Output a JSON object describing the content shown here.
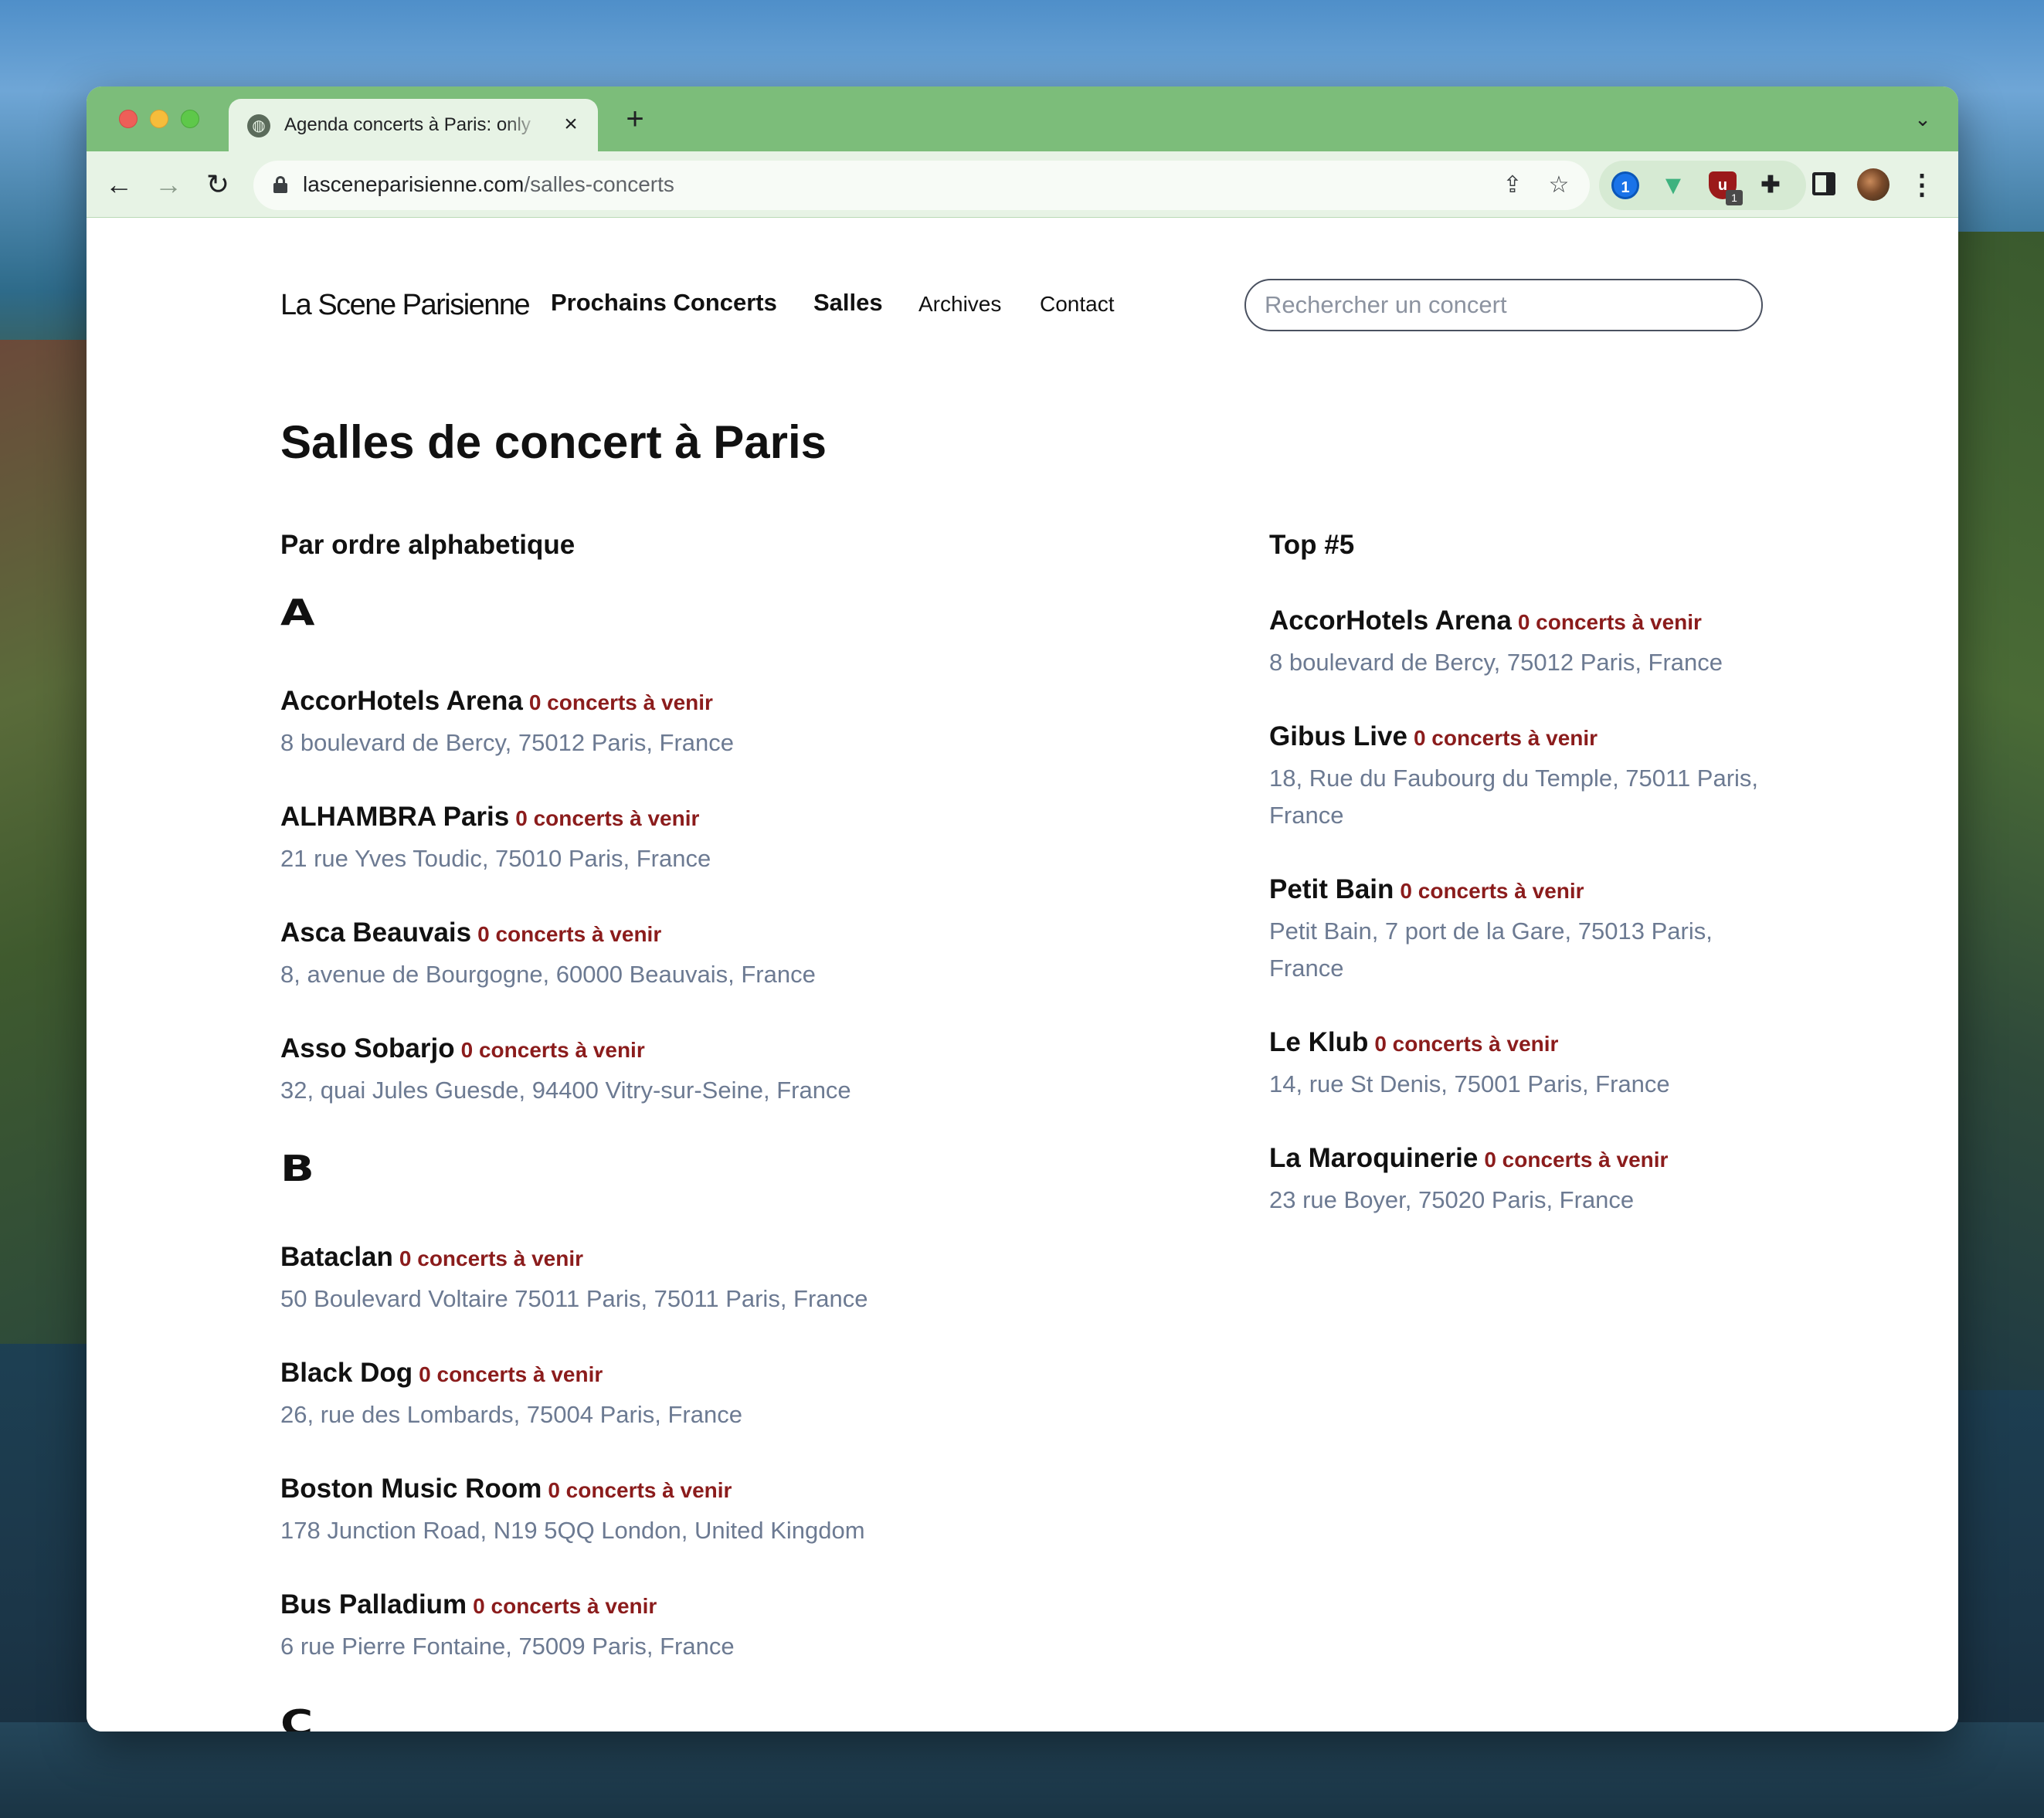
{
  "browser": {
    "tab_title": "Agenda concerts à Paris: only",
    "close_icon": "×",
    "new_tab_icon": "+",
    "tab_list_icon": "⌄",
    "url_host": "lasceneparisienne.com",
    "url_path": "/salles-concerts",
    "ublock_badge": "1",
    "colors": {
      "tabbar": "#7cbd7a",
      "toolbar": "#e7f3e5"
    }
  },
  "site": {
    "logo": "La Scene Parisienne",
    "nav": {
      "upcoming": "Prochains Concerts",
      "venues": "Salles",
      "archives": "Archives",
      "contact": "Contact"
    },
    "search_placeholder": "Rechercher un concert"
  },
  "main": {
    "title": "Salles de concert à Paris",
    "alphabetical": {
      "heading": "Par ordre alphabetique",
      "groups": [
        {
          "letter": "A",
          "venues": [
            {
              "name": "AccorHotels Arena",
              "count": "0 concerts à venir",
              "address": "8 boulevard de Bercy, 75012 Paris, France"
            },
            {
              "name": "ALHAMBRA Paris",
              "count": "0 concerts à venir",
              "address": "21 rue Yves Toudic, 75010 Paris, France"
            },
            {
              "name": "Asca Beauvais",
              "count": "0 concerts à venir",
              "address": "8, avenue de Bourgogne, 60000 Beauvais, France"
            },
            {
              "name": "Asso Sobarjo",
              "count": "0 concerts à venir",
              "address": "32, quai Jules Guesde, 94400 Vitry-sur-Seine, France"
            }
          ]
        },
        {
          "letter": "B",
          "venues": [
            {
              "name": "Bataclan",
              "count": "0 concerts à venir",
              "address": "50 Boulevard Voltaire 75011 Paris, 75011 Paris, France"
            },
            {
              "name": "Black Dog",
              "count": "0 concerts à venir",
              "address": "26, rue des Lombards, 75004 Paris, France"
            },
            {
              "name": "Boston Music Room",
              "count": "0 concerts à venir",
              "address": "178 Junction Road, N19 5QQ London, United Kingdom"
            },
            {
              "name": "Bus Palladium",
              "count": "0 concerts à venir",
              "address": "6 rue Pierre Fontaine, 75009 Paris, France"
            }
          ]
        },
        {
          "letter": "C",
          "venues": []
        }
      ]
    },
    "top": {
      "heading": "Top #5",
      "venues": [
        {
          "name": "AccorHotels Arena",
          "count": "0 concerts à venir",
          "address": "8 boulevard de Bercy, 75012 Paris, France"
        },
        {
          "name": "Gibus Live",
          "count": "0 concerts à venir",
          "address": "18, Rue du Faubourg du Temple, 75011 Paris, France"
        },
        {
          "name": "Petit Bain",
          "count": "0 concerts à venir",
          "address": "Petit Bain, 7 port de la Gare, 75013 Paris, France"
        },
        {
          "name": "Le Klub",
          "count": "0 concerts à venir",
          "address": "14, rue St Denis, 75001 Paris, France"
        },
        {
          "name": "La Maroquinerie",
          "count": "0 concerts à venir",
          "address": "23 rue Boyer, 75020 Paris, France"
        }
      ]
    },
    "colors": {
      "count": "#8b1c1c",
      "address": "#6c7a92"
    }
  }
}
